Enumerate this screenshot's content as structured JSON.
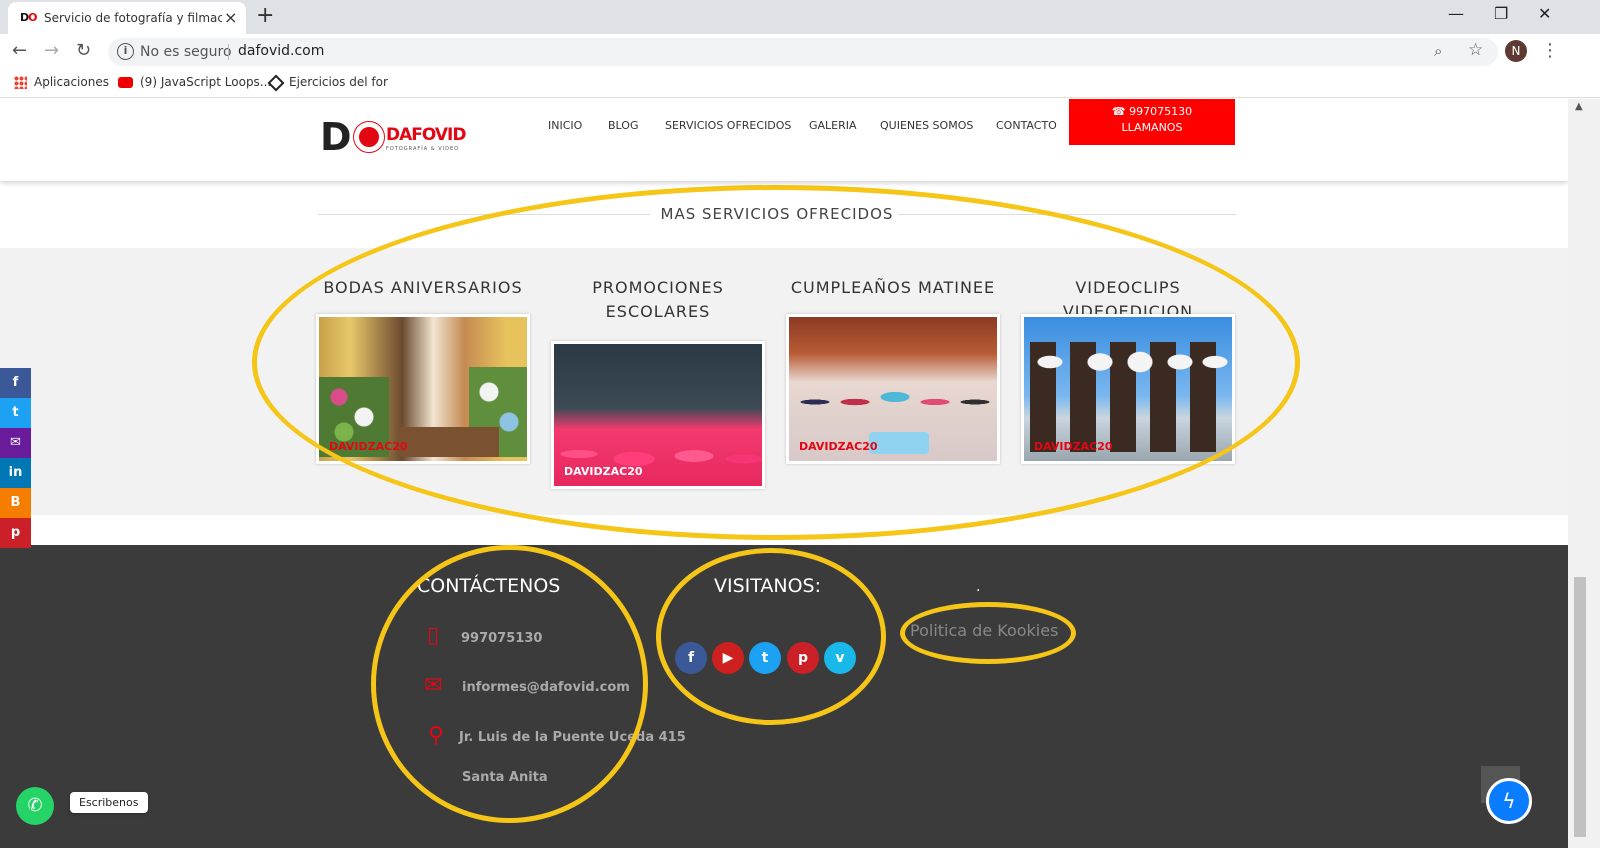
{
  "browser": {
    "tab_title": "Servicio de fotografía y filmación",
    "tab_favicon": "DO",
    "address_prefix": "No es seguro",
    "url": "dafovid.com",
    "profile_initial": "N",
    "bookmarks": [
      {
        "label": "Aplicaciones",
        "icon": "apps-grid-icon"
      },
      {
        "label": "(9) JavaScript Loops...",
        "icon": "youtube-icon"
      },
      {
        "label": "Ejercicios del for",
        "icon": "codepen-icon"
      }
    ]
  },
  "header": {
    "logo_mark": "D",
    "logo_name": "DAFOVID",
    "logo_tagline": "FOTOGRAFÍA & VIDEO",
    "nav": [
      "INICIO",
      "BLOG",
      "SERVICIOS OFRECIDOS",
      "GALERIA",
      "QUIENES SOMOS",
      "CONTACTO"
    ],
    "cta_phone": "997075130",
    "cta_label": "LLAMANOS"
  },
  "services": {
    "section_title": "MAS SERVICIOS OFRECIDOS",
    "items": [
      {
        "title": "BODAS ANIVERSARIOS",
        "watermark": "DAVIDZAC20"
      },
      {
        "title": "PROMOCIONES ESCOLARES",
        "watermark": "DAVIDZAC20"
      },
      {
        "title": "CUMPLEAÑOS MATINEE",
        "watermark": "DAVIDZAC20"
      },
      {
        "title": "VIDEOCLIPS VIDEOEDICION",
        "watermark": "DAVIDZAC20"
      }
    ]
  },
  "footer": {
    "contact_title": "CONTÁCTENOS",
    "phone": "997075130",
    "email": "informes@dafovid.com",
    "address": "Jr. Luis de la Puente Uceda 415",
    "district": "Santa Anita",
    "visit_title": "VISITANOS:",
    "policy_link": "Politica de Kookies",
    "dot": "."
  },
  "floating": {
    "whatsapp_tip": "Escribenos"
  },
  "colors": {
    "brand_red": "#ff0000",
    "footer_bg": "#3b3b3b",
    "highlight_ring": "#f5c518"
  }
}
